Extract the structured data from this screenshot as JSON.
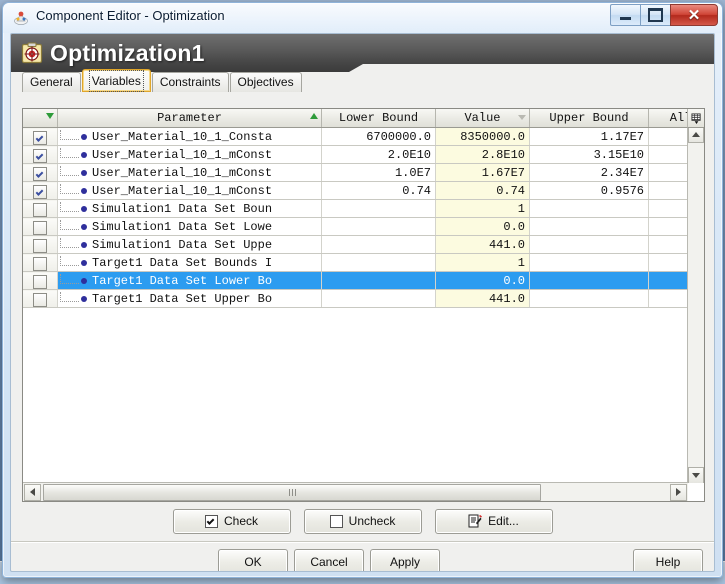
{
  "window": {
    "title": "Component Editor - Optimization",
    "icon": "app-icon",
    "controls": {
      "minimize": "–",
      "maximize": "□",
      "close": "✕"
    }
  },
  "banner": {
    "title": "Optimization1",
    "icon": "optimization-target-icon"
  },
  "tabs": [
    {
      "label": "General",
      "selected": false
    },
    {
      "label": "Variables",
      "selected": true
    },
    {
      "label": "Constraints",
      "selected": false
    },
    {
      "label": "Objectives",
      "selected": false
    }
  ],
  "table": {
    "columns": [
      {
        "key": "check",
        "label": "",
        "sort": "down"
      },
      {
        "key": "parameter",
        "label": "Parameter",
        "sort": "up"
      },
      {
        "key": "lower",
        "label": "Lower Bound",
        "sort": "none"
      },
      {
        "key": "value",
        "label": "Value",
        "sort": "small"
      },
      {
        "key": "upper",
        "label": "Upper Bound",
        "sort": "none"
      },
      {
        "key": "allowed",
        "label": "Allowed",
        "sort": "none"
      }
    ],
    "column_chooser_icon": "column-chooser-icon",
    "rows": [
      {
        "checked": true,
        "parameter": "User_Material_10_1_Consta",
        "lower": "6700000.0",
        "value": "8350000.0",
        "upper": "1.17E7",
        "allowed": "",
        "selected": false
      },
      {
        "checked": true,
        "parameter": "User_Material_10_1_mConst",
        "lower": "2.0E10",
        "value": "2.8E10",
        "upper": "3.15E10",
        "allowed": "",
        "selected": false
      },
      {
        "checked": true,
        "parameter": "User_Material_10_1_mConst",
        "lower": "1.0E7",
        "value": "1.67E7",
        "upper": "2.34E7",
        "allowed": "",
        "selected": false
      },
      {
        "checked": true,
        "parameter": "User_Material_10_1_mConst",
        "lower": "0.74",
        "value": "0.74",
        "upper": "0.9576",
        "allowed": "",
        "selected": false
      },
      {
        "checked": false,
        "parameter": "Simulation1 Data Set Boun",
        "lower": "",
        "value": "1",
        "upper": "",
        "allowed": "",
        "selected": false
      },
      {
        "checked": false,
        "parameter": "Simulation1 Data Set Lowe",
        "lower": "",
        "value": "0.0",
        "upper": "",
        "allowed": "",
        "selected": false
      },
      {
        "checked": false,
        "parameter": "Simulation1 Data Set Uppe",
        "lower": "",
        "value": "441.0",
        "upper": "",
        "allowed": "",
        "selected": false
      },
      {
        "checked": false,
        "parameter": "Target1 Data Set Bounds I",
        "lower": "",
        "value": "1",
        "upper": "",
        "allowed": "",
        "selected": false
      },
      {
        "checked": false,
        "parameter": "Target1 Data Set Lower Bo",
        "lower": "",
        "value": "0.0",
        "upper": "",
        "allowed": "",
        "selected": true
      },
      {
        "checked": false,
        "parameter": "Target1 Data Set Upper Bo",
        "lower": "",
        "value": "441.0",
        "upper": "",
        "allowed": "",
        "selected": false
      }
    ]
  },
  "mid_buttons": [
    {
      "label": "Check",
      "icon": "checkbox-checked-icon",
      "checked": true
    },
    {
      "label": "Uncheck",
      "icon": "checkbox-unchecked-icon",
      "checked": false
    },
    {
      "label": "Edit...",
      "icon": "edit-pencil-icon",
      "checked": null
    }
  ],
  "bottom_buttons": {
    "ok": "OK",
    "cancel": "Cancel",
    "apply": "Apply",
    "help": "Help"
  },
  "colors": {
    "selection": "#2c9cf0",
    "value_column": "#fcfbe0",
    "banner": "#5b5b5b",
    "close_button": "#cf4436",
    "sort_arrow": "#2e9b3a"
  }
}
